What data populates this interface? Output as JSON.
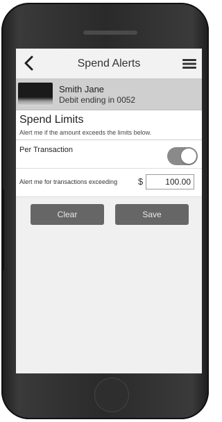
{
  "navbar": {
    "title": "Spend Alerts",
    "back_icon": "chevron-left-icon",
    "menu_icon": "hamburger-menu-icon"
  },
  "card": {
    "name": "Smith Jane",
    "subtitle": "Debit ending in 0052"
  },
  "spend_limits": {
    "title": "Spend Limits",
    "description": "Alert me if the amount exceeds the limits below.",
    "per_transaction_label": "Per Transaction",
    "per_transaction_enabled": true,
    "amount_label": "Alert me for transactions exceeding",
    "currency_symbol": "$",
    "amount_value": "100.00"
  },
  "actions": {
    "clear_label": "Clear",
    "save_label": "Save"
  }
}
